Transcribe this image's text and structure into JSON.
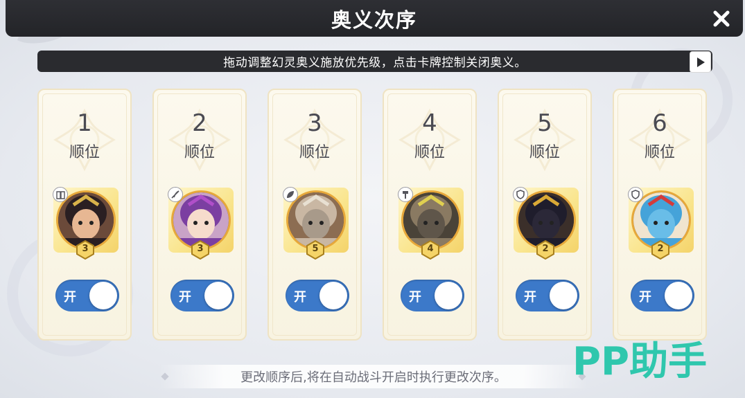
{
  "header": {
    "title": "奥义次序"
  },
  "hint": {
    "text": "拖动调整幻灵奥义施放优先级，点击卡牌控制关闭奥义。"
  },
  "cards": [
    {
      "rank": "1",
      "rank_label": "顺位",
      "stars": "3",
      "toggle_label": "开",
      "element": "book-icon",
      "portrait": {
        "bg": "#6b4a3a",
        "hair": "#2a1f22",
        "face": "#e7b793",
        "accent": "#d8b24a"
      }
    },
    {
      "rank": "2",
      "rank_label": "顺位",
      "stars": "3",
      "toggle_label": "开",
      "element": "quill-icon",
      "portrait": {
        "bg": "#c9a3c7",
        "hair": "#7b3fa1",
        "face": "#f6dccc",
        "accent": "#b04fc9"
      }
    },
    {
      "rank": "3",
      "rank_label": "顺位",
      "stars": "5",
      "toggle_label": "开",
      "element": "leaf-icon",
      "portrait": {
        "bg": "#8c6d52",
        "hair": "#c9b7a3",
        "face": "#a89a8a",
        "accent": "#e8e0d2"
      }
    },
    {
      "rank": "4",
      "rank_label": "顺位",
      "stars": "4",
      "toggle_label": "开",
      "element": "hammer-icon",
      "portrait": {
        "bg": "#4a4338",
        "hair": "#8a7a62",
        "face": "#5f564a",
        "accent": "#e0d050"
      }
    },
    {
      "rank": "5",
      "rank_label": "顺位",
      "stars": "2",
      "toggle_label": "开",
      "element": "shield-icon",
      "portrait": {
        "bg": "#3b2f2a",
        "hair": "#1f1d2c",
        "face": "#2b2838",
        "accent": "#d9a936"
      }
    },
    {
      "rank": "6",
      "rank_label": "顺位",
      "stars": "2",
      "toggle_label": "开",
      "element": "shield-icon",
      "portrait": {
        "bg": "#f0e4cf",
        "hair": "#45a3d9",
        "face": "#69bde8",
        "accent": "#d43b3b"
      }
    }
  ],
  "footer": {
    "text": "更改顺序后,将在自动战斗开启时执行更改次序。"
  },
  "watermark": {
    "text": "PP助手",
    "color": "#2fc7ad"
  },
  "colors": {
    "toggle_on": "#3c79c9",
    "title_bar": "#2a2b2f",
    "card_bg": "#fcf9ee"
  }
}
